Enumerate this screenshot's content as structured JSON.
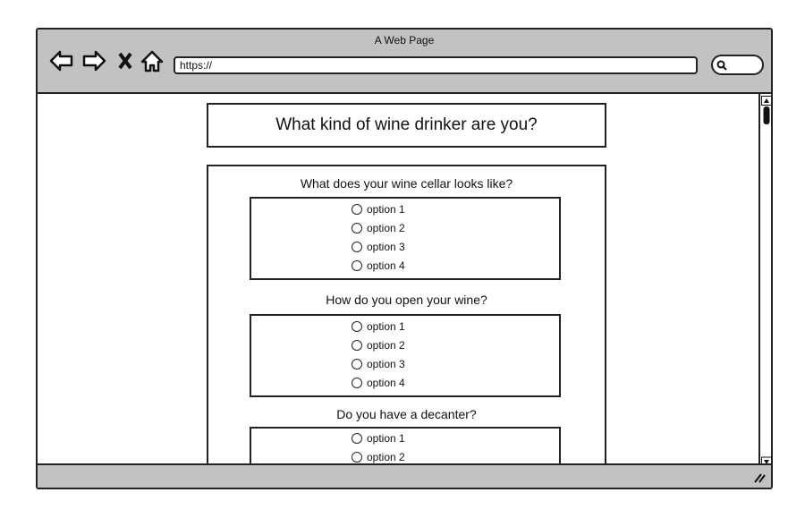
{
  "browser": {
    "title": "A Web Page",
    "url": "https://"
  },
  "page": {
    "heading": "What kind of wine drinker are you?"
  },
  "questions": [
    {
      "label": "What does your wine cellar looks like?",
      "options": [
        "option 1",
        "option 2",
        "option 3",
        "option 4"
      ]
    },
    {
      "label": "How do you open your wine?",
      "options": [
        "option 1",
        "option 2",
        "option 3",
        "option 4"
      ]
    },
    {
      "label": "Do you have a decanter?",
      "options": [
        "option 1",
        "option 2"
      ]
    }
  ]
}
